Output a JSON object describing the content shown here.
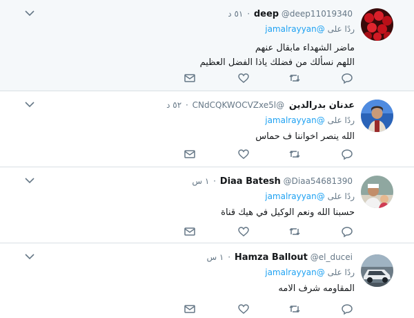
{
  "tweets": [
    {
      "name": "deep",
      "handle": "@deep11019340",
      "time": "٥١ د",
      "reply_prefix": "ردًا على",
      "reply_to": "@jamalrayyan",
      "lines": [
        "ماضر الشهداء مابقال عنهم",
        "اللهم نسألك من فضلك ياذا الفضل العظيم"
      ],
      "avatar_icon": "flowers-avatar"
    },
    {
      "name": "عدنان بدرالدين",
      "handle": "@CNdCQKWOCVZxe5l",
      "time": "٥٢ د",
      "reply_prefix": "ردًا على",
      "reply_to": "@jamalrayyan",
      "lines": [
        "الله ينصر اخواننا ف حماس"
      ],
      "avatar_icon": "person-avatar"
    },
    {
      "name": "Diaa Batesh",
      "handle": "@Diaa54681390",
      "time": "١ س",
      "reply_prefix": "ردًا على",
      "reply_to": "@jamalrayyan",
      "lines": [
        "حسبنا الله ونعم الوكيل في هيك قناة"
      ],
      "avatar_icon": "person-avatar"
    },
    {
      "name": "Hamza Ballout",
      "handle": "@el_ducei",
      "time": "١ س",
      "reply_prefix": "ردًا على",
      "reply_to": "@jamalrayyan",
      "lines": [
        "المقاومه شرف الامه"
      ],
      "avatar_icon": "car-avatar"
    }
  ],
  "colors": {
    "link": "#1da1f2",
    "muted": "#657786",
    "highlight_bg": "#f5f8fa"
  },
  "icons": {
    "reply": "reply-icon",
    "retweet": "retweet-icon",
    "like": "like-icon",
    "dm": "dm-icon",
    "more": "chevron-down-icon"
  }
}
